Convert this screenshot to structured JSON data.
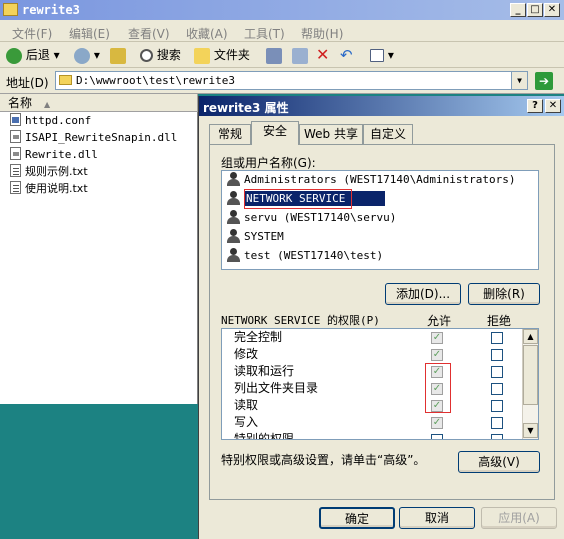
{
  "explorer": {
    "title": "rewrite3",
    "menu": [
      "文件(F)",
      "编辑(E)",
      "查看(V)",
      "收藏(A)",
      "工具(T)",
      "帮助(H)"
    ],
    "toolbar": {
      "back": "后退",
      "search": "搜索",
      "folders": "文件夹"
    },
    "address_label": "地址(D)",
    "address_value": "D:\\wwwroot\\test\\rewrite3",
    "column_name": "名称",
    "files": [
      {
        "name": "httpd.conf",
        "icon": "conf-file-icon"
      },
      {
        "name": "ISAPI_RewriteSnapin.dll",
        "icon": "dll-file-icon"
      },
      {
        "name": "Rewrite.dll",
        "icon": "dll-file-icon"
      },
      {
        "name": "规则示例.txt",
        "icon": "text-file-icon"
      },
      {
        "name": "使用说明.txt",
        "icon": "text-file-icon"
      }
    ]
  },
  "dialog": {
    "title": "rewrite3 属性",
    "tabs": [
      "常规",
      "安全",
      "Web 共享",
      "自定义"
    ],
    "active_tab": "安全",
    "users_label": "组或用户名称(G):",
    "users": [
      "Administrators (WEST17140\\Administrators)",
      "NETWORK SERVICE",
      "servu (WEST17140\\servu)",
      "SYSTEM",
      "test (WEST17140\\test)"
    ],
    "selected_user": "NETWORK SERVICE",
    "add_button": "添加(D)...",
    "remove_button": "删除(R)",
    "perm_label": "NETWORK SERVICE 的权限(P)",
    "allow_header": "允许",
    "deny_header": "拒绝",
    "permissions": [
      "完全控制",
      "修改",
      "读取和运行",
      "列出文件夹目录",
      "读取",
      "写入",
      "特别的权限"
    ],
    "advanced_note": "特别权限或高级设置，请单击“高级”。",
    "advanced_button": "高级(V)",
    "ok_button": "确定",
    "cancel_button": "取消",
    "apply_button": "应用(A)",
    "highlight_color": "#e03030",
    "selection_color": "#0a246a"
  }
}
